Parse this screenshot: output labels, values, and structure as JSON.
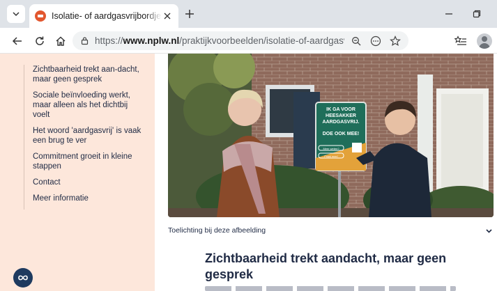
{
  "browser": {
    "tab": {
      "title": "Isolatie- of aardgasvrijbordjes in de"
    },
    "address_bar": {
      "scheme": "https://",
      "domain": "www.nplw.nl",
      "path": "/praktijkvoorbeelden/isolatie-of-aardgasvrijbordjes-in-de..."
    },
    "icons": [
      "tab-list-icon",
      "favicon",
      "close-icon",
      "new-tab-icon",
      "minimize-icon",
      "restore-icon",
      "back-icon",
      "reload-icon",
      "home-icon",
      "lock-icon",
      "zoom-icon",
      "more-icon",
      "favorite-icon",
      "favorites-bar-icon",
      "profile-icon"
    ]
  },
  "sidebar": {
    "items": [
      {
        "label": "Zichtbaarheid trekt aan-dacht, maar geen gesprek"
      },
      {
        "label": "Sociale beïnvloeding werkt, maar alleen als het dichtbij voelt"
      },
      {
        "label": "Het woord 'aardgasvrij' is vaak een brug te ver"
      },
      {
        "label": "Commitment groeit in kleine stappen"
      },
      {
        "label": "Contact"
      },
      {
        "label": "Meer informatie"
      }
    ],
    "chat_icon": "infinity-icon"
  },
  "photo": {
    "sign_lines": [
      "IK GA VOOR",
      "HEESAKKER",
      "AARDGASVRIJ.",
      "DOE OOK MEE!"
    ],
    "sign_buttons": [
      "Meer weten?",
      "Praat mee!"
    ]
  },
  "caption": {
    "text": "Toelichting bij deze afbeelding",
    "icon": "chevron-down-icon"
  },
  "article": {
    "headline": "Zichtbaarheid trekt aandacht, maar geen gesprek"
  },
  "colors": {
    "sidebar_bg": "#fde7db",
    "text": "#1f2a44",
    "accent": "#1e3a5f",
    "favicon": "#e2572f",
    "sign_green": "#1f6e5a"
  }
}
